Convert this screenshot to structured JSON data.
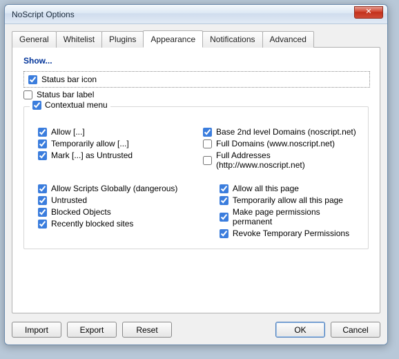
{
  "window": {
    "title": "NoScript Options"
  },
  "tabs": {
    "general": "General",
    "whitelist": "Whitelist",
    "plugins": "Plugins",
    "appearance": "Appearance",
    "notifications": "Notifications",
    "advanced": "Advanced"
  },
  "show": {
    "heading": "Show...",
    "status_bar_icon": {
      "label": "Status bar icon",
      "checked": true
    },
    "status_bar_label": {
      "label": "Status bar label",
      "checked": false
    }
  },
  "contextual": {
    "legend": "Contextual menu",
    "legend_checked": true,
    "left": {
      "allow": {
        "label": "Allow [...]",
        "checked": true
      },
      "temp_allow": {
        "label": "Temporarily allow [...]",
        "checked": true
      },
      "mark_untrust": {
        "label": "Mark [...] as Untrusted",
        "checked": true
      }
    },
    "right": {
      "base_2nd": {
        "label": "Base 2nd level Domains (noscript.net)",
        "checked": true
      },
      "full_dom": {
        "label": "Full Domains (www.noscript.net)",
        "checked": false
      },
      "full_addr": {
        "label": "Full Addresses (http://www.noscript.net)",
        "checked": false
      }
    },
    "lower_left": {
      "global": {
        "label": "Allow Scripts Globally (dangerous)",
        "checked": true
      },
      "untrusted": {
        "label": "Untrusted",
        "checked": true
      },
      "blocked": {
        "label": "Blocked Objects",
        "checked": true
      },
      "recent": {
        "label": "Recently blocked sites",
        "checked": true
      }
    },
    "lower_right": {
      "allow_page": {
        "label": "Allow all this page",
        "checked": true
      },
      "temp_page": {
        "label": "Temporarily allow all this page",
        "checked": true
      },
      "make_perm": {
        "label": "Make page permissions permanent",
        "checked": true
      },
      "revoke_temp": {
        "label": "Revoke Temporary Permissions",
        "checked": true
      }
    }
  },
  "buttons": {
    "import": "Import",
    "export": "Export",
    "reset": "Reset",
    "ok": "OK",
    "cancel": "Cancel"
  }
}
